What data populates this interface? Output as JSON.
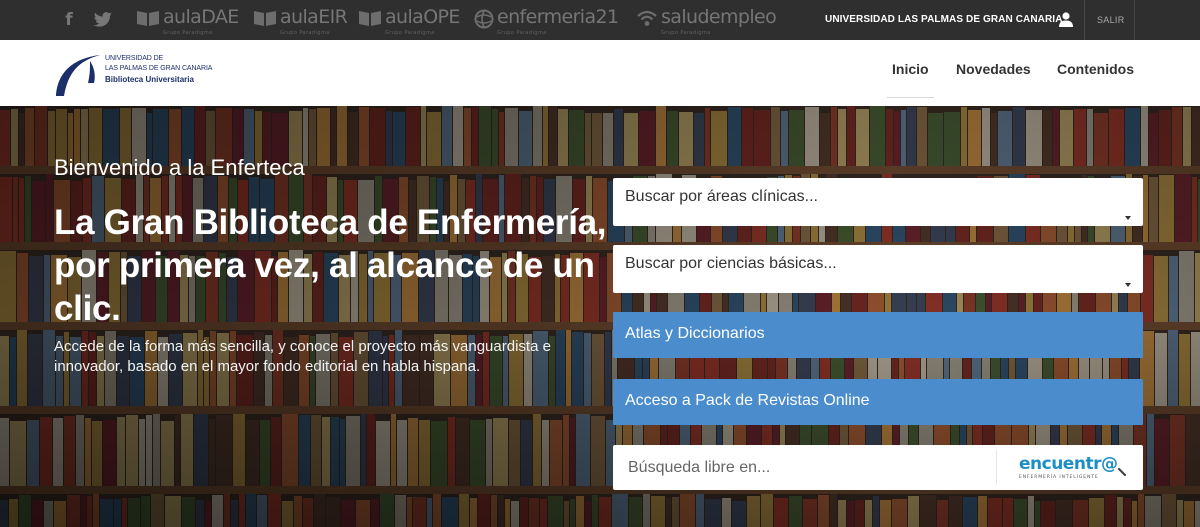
{
  "topbar": {
    "social": [
      "facebook-icon",
      "twitter-icon"
    ],
    "brands": [
      {
        "name": "aulaDAE",
        "tag": "Grupo Paradigma"
      },
      {
        "name": "aulaEIR",
        "tag": "Grupo Paradigma"
      },
      {
        "name": "aulaOPE",
        "tag": "Grupo Paradigma"
      },
      {
        "name": "enfermeria21",
        "tag": "Grupo Paradigma"
      },
      {
        "name": "saludempleo",
        "tag": "Grupo Paradigma"
      }
    ],
    "university_label": "UNIVERSIDAD LAS PALMAS DE GRAN CANARIA",
    "user_icon": "user-icon",
    "logout_label": "SALIR",
    "bg_color": "#2f2f2f"
  },
  "logo": {
    "line1": "UNIVERSIDAD DE",
    "line2": "LAS PALMAS DE GRAN CANARIA",
    "line3": "Biblioteca Universitaria",
    "color": "#1d2f6b"
  },
  "nav": {
    "items": [
      {
        "label": "Inicio",
        "active": true
      },
      {
        "label": "Novedades",
        "active": false
      },
      {
        "label": "Contenidos",
        "active": false
      }
    ]
  },
  "hero": {
    "welcome": "Bienvenido a la Enferteca",
    "headline": "La Gran Biblioteca de Enfermería, por primera vez, al alcance de un clic.",
    "description": "Accede de la forma más sencilla, y conoce el proyecto más vanguardista e innovador, basado en el mayor fondo editorial en habla hispana."
  },
  "search_panel": {
    "select_clinical": "Buscar por áreas clínicas...",
    "select_basic": "Buscar por ciencias básicas...",
    "btn_atlas": "Atlas y Diccionarios",
    "btn_journals": "Acceso a Pack de Revistas Online",
    "free_search_placeholder": "Búsqueda libre en...",
    "encuentra_word": "encuentr@",
    "encuentra_tag": "ENFERMERÍA INTELIGENTE",
    "accent_color": "#4a8ccc"
  }
}
